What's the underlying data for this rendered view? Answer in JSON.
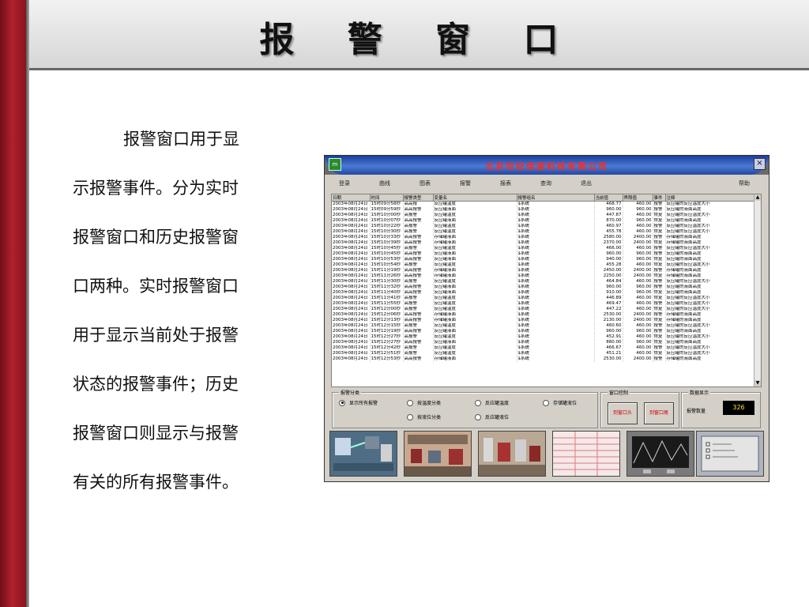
{
  "page": {
    "title": "报 警 窗 口",
    "description_lines": [
      "报警窗口用于显",
      "示报警事件。分为实时",
      "报警窗口和历史报警窗",
      "口两种。实时报警窗口",
      "用于显示当前处于报警",
      "状态的报警事件；历史",
      "报警窗口则显示与报警",
      "有关的所有报警事件。"
    ]
  },
  "app": {
    "title": "北京世纪佳丽科技有限公司",
    "logo_text": "m",
    "close_glyph": "×",
    "menu": [
      "登录",
      "曲线",
      "图表",
      "报警",
      "报表",
      "查询",
      "退出"
    ],
    "help_label": "帮助",
    "table": {
      "columns": [
        "日期",
        "时间",
        "报警类型",
        "变量名",
        "报警组名",
        "当前值",
        "界限值",
        "事件",
        "注释"
      ],
      "rows": [
        [
          "2003年08月24日",
          "15时09分58秒",
          "高高报",
          "反应罐温度",
          "$系统",
          "468.77",
          "460.00",
          "报警",
          "反应罐的反应温度大小"
        ],
        [
          "2003年08月24日",
          "15时09分59秒",
          "高高报警",
          "反应罐液面",
          "$系统",
          "960.00",
          "960.00",
          "报警",
          "反应罐的液面高度"
        ],
        [
          "2003年08月24日",
          "15时10分00秒",
          "高报警",
          "反应罐温度",
          "$系统",
          "447.87",
          "460.00",
          "恢复",
          "反应罐的反应温度大小"
        ],
        [
          "2003年08月24日",
          "15时10分07秒",
          "高高报警",
          "反应罐液面",
          "$系统",
          "870.00",
          "960.00",
          "恢复",
          "反应罐的液面高度"
        ],
        [
          "2003年08月24日",
          "15时10分22秒",
          "高报警",
          "反应罐温度",
          "$系统",
          "460.97",
          "460.00",
          "报警",
          "反应罐的反应温度大小"
        ],
        [
          "2003年08月24日",
          "15时10分30秒",
          "高报警",
          "反应罐温度",
          "$系统",
          "455.78",
          "460.00",
          "恢复",
          "反应罐的反应温度大小"
        ],
        [
          "2003年08月24日",
          "15时10分33秒",
          "高高报警",
          "存储罐液面",
          "$系统",
          "2580.00",
          "2400.00",
          "报警",
          "存储罐的液面高度"
        ],
        [
          "2003年08月24日",
          "15时10分39秒",
          "高高报警",
          "存储罐液面",
          "$系统",
          "2370.00",
          "2400.00",
          "恢复",
          "存储罐的液面高度"
        ],
        [
          "2003年08月24日",
          "15时10分45秒",
          "高报警",
          "反应罐温度",
          "$系统",
          "466.00",
          "460.00",
          "报警",
          "反应罐的反应温度大小"
        ],
        [
          "2003年08月24日",
          "15时10分45秒",
          "高高报警",
          "反应罐液面",
          "$系统",
          "960.00",
          "960.00",
          "报警",
          "反应罐的液面高度"
        ],
        [
          "2003年08月24日",
          "15时10分53秒",
          "高高报警",
          "反应罐液面",
          "$系统",
          "940.00",
          "960.00",
          "恢复",
          "反应罐的液面高度"
        ],
        [
          "2003年08月24日",
          "15时10分54秒",
          "高报警",
          "反应罐温度",
          "$系统",
          "455.28",
          "460.00",
          "恢复",
          "反应罐的反应温度大小"
        ],
        [
          "2003年08月24日",
          "15时11分19秒",
          "高高报警",
          "存储罐液面",
          "$系统",
          "2450.00",
          "2400.00",
          "报警",
          "存储罐的液面高度"
        ],
        [
          "2003年08月24日",
          "15时11分26秒",
          "高高报警",
          "存储罐液面",
          "$系统",
          "2250.00",
          "2400.00",
          "恢复",
          "存储罐的液面高度"
        ],
        [
          "2003年08月24日",
          "15时11分30秒",
          "高报警",
          "反应罐温度",
          "$系统",
          "464.84",
          "460.00",
          "报警",
          "反应罐的反应温度大小"
        ],
        [
          "2003年08月24日",
          "15时11分32秒",
          "高高报警",
          "反应罐液面",
          "$系统",
          "960.00",
          "960.00",
          "报警",
          "反应罐的液面高度"
        ],
        [
          "2003年08月24日",
          "15时11分40秒",
          "高高报警",
          "反应罐液面",
          "$系统",
          "910.00",
          "960.00",
          "恢复",
          "反应罐的液面高度"
        ],
        [
          "2003年08月24日",
          "15时11分41秒",
          "高报警",
          "反应罐温度",
          "$系统",
          "446.89",
          "460.00",
          "恢复",
          "反应罐的反应温度大小"
        ],
        [
          "2003年08月24日",
          "15时11分55秒",
          "高报警",
          "反应罐温度",
          "$系统",
          "469.47",
          "460.00",
          "报警",
          "反应罐的反应温度大小"
        ],
        [
          "2003年08月24日",
          "15时12分00秒",
          "高报警",
          "反应罐温度",
          "$系统",
          "447.22",
          "460.00",
          "恢复",
          "反应罐的反应温度大小"
        ],
        [
          "2003年08月24日",
          "15时12分06秒",
          "高高报警",
          "存储罐液面",
          "$系统",
          "2530.00",
          "2400.00",
          "报警",
          "存储罐的液面高度"
        ],
        [
          "2003年08月24日",
          "15时12分13秒",
          "高高报警",
          "存储罐液面",
          "$系统",
          "2130.00",
          "2400.00",
          "恢复",
          "存储罐的液面高度"
        ],
        [
          "2003年08月24日",
          "15时12分15秒",
          "高报警",
          "反应罐温度",
          "$系统",
          "460.60",
          "460.00",
          "报警",
          "反应罐的反应温度大小"
        ],
        [
          "2003年08月24日",
          "15时12分19秒",
          "高高报警",
          "反应罐液面",
          "$系统",
          "960.00",
          "960.00",
          "报警",
          "反应罐的液面高度"
        ],
        [
          "2003年08月24日",
          "15时12分27秒",
          "高报警",
          "反应罐温度",
          "$系统",
          "452.91",
          "460.00",
          "恢复",
          "反应罐的反应温度大小"
        ],
        [
          "2003年08月24日",
          "15时12分27秒",
          "高高报警",
          "反应罐液面",
          "$系统",
          "880.00",
          "960.00",
          "恢复",
          "反应罐的液面高度"
        ],
        [
          "2003年08月24日",
          "15时12分42秒",
          "高报警",
          "反应罐温度",
          "$系统",
          "466.67",
          "460.00",
          "报警",
          "反应罐的反应温度大小"
        ],
        [
          "2003年08月24日",
          "15时12分51秒",
          "高报警",
          "反应罐温度",
          "$系统",
          "451.21",
          "460.00",
          "恢复",
          "反应罐的反应温度大小"
        ],
        [
          "2003年08月24日",
          "15时12分53秒",
          "高高报警",
          "存储罐液面",
          "$系统",
          "2530.00",
          "2400.00",
          "报警",
          "存储罐的液面高度"
        ]
      ]
    },
    "category_group": {
      "label": "报警分类",
      "options": [
        "显示所有报警",
        "按温度分类",
        "反应罐温度",
        "存储罐液位",
        "按液位分类",
        "反应罐液位"
      ],
      "selected": "显示所有报警"
    },
    "window_group": {
      "label": "窗口控制",
      "buttons": [
        "到窗口头",
        "到窗口尾"
      ]
    },
    "display_group": {
      "label": "数据显示",
      "count_label": "报警数量",
      "count_value": "326"
    }
  }
}
